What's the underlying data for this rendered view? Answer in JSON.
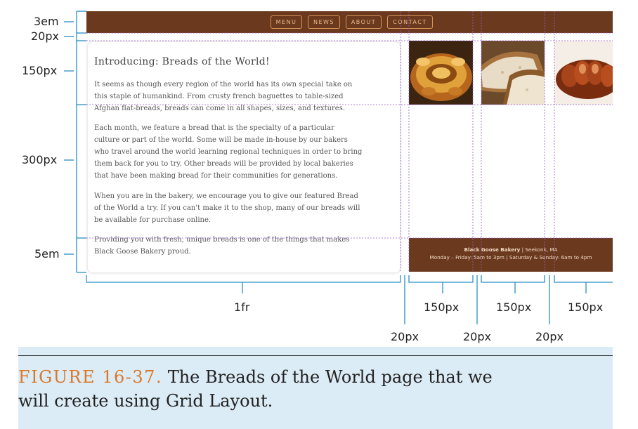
{
  "nav": {
    "items": [
      "MENU",
      "NEWS",
      "ABOUT",
      "CONTACT"
    ]
  },
  "article": {
    "title": "Introducing: Breads of the World!",
    "paragraphs": [
      [
        "It seems as though every region of the world has its own special take on",
        "this staple of humankind. From crusty french baguettes to table-sized",
        "Afghan flat-breads, breads can come in all shapes, sizes, and textures."
      ],
      [
        "Each month, we feature a bread that is the specialty of a particular",
        "culture or part of the world. Some will be made in-house by our bakers",
        "who travel around the world learning regional techniques in order to bring",
        "them back for you to try. Other breads will be provided by local bakeries",
        "that have been making bread for their communities for generations."
      ],
      [
        "When you are in the bakery, we encourage you to give our featured Bread",
        "of the World a try. If you can't make it to the shop, many of our breads will",
        "be available for purchase online."
      ],
      [
        "Providing you with fresh, unique breads is one of the things that makes",
        "Black Goose Bakery proud."
      ]
    ]
  },
  "footer": {
    "name": "Black Goose Bakery",
    "location": " | Seekonk, MA",
    "hours": "Monday – Friday: 5am to 3pm | Saturday & Sunday: 6am to 4pm"
  },
  "row_labels": [
    "3em",
    "20px",
    "150px",
    "300px",
    "5em"
  ],
  "column_labels": [
    "1fr",
    "150px",
    "150px",
    "150px"
  ],
  "gap_labels": [
    "20px",
    "20px",
    "20px"
  ],
  "caption": {
    "figure": "FIGURE 16-37.",
    "text_line1": " The Breads of the World page that we",
    "text_line2": "will create using Grid Layout."
  },
  "colors": {
    "nav_bg": "#6b3a1e",
    "dimension_line": "#2a8fc4",
    "grid_line": "#9b59d0",
    "caption_accent": "#d9782a",
    "panel_bg": "#dcecf6"
  }
}
